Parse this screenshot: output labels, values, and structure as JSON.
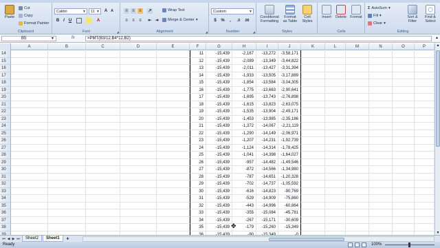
{
  "ribbon": {
    "clipboard": {
      "paste": "Paste",
      "cut": "Cut",
      "copy": "Copy",
      "format_painter": "Format Painter",
      "label": "Clipboard"
    },
    "font": {
      "name": "Calibri",
      "size": "11",
      "label": "Font"
    },
    "alignment": {
      "wrap": "Wrap Text",
      "merge": "Merge & Center",
      "label": "Alignment"
    },
    "number": {
      "format": "Custom",
      "label": "Number"
    },
    "styles": {
      "cond": "Conditional Formatting",
      "table": "Format as Table",
      "cell": "Cell Styles",
      "label": "Styles"
    },
    "cells": {
      "insert": "Insert",
      "delete": "Delete",
      "format": "Format",
      "label": "Cells"
    },
    "editing": {
      "autosum": "AutoSum",
      "fill": "Fill",
      "clear": "Clear",
      "sort": "Sort & Filter",
      "find": "Find & Select",
      "label": "Editing"
    }
  },
  "formula_bar": {
    "name_box": "B5",
    "fx": "fx",
    "formula": "=PMT(B3/12,B4*12,B2)"
  },
  "columns": [
    "A",
    "B",
    "C",
    "D",
    "E",
    "F",
    "G",
    "H",
    "I",
    "J",
    "K",
    "L",
    "M",
    "N",
    "O",
    "P"
  ],
  "rows": [
    {
      "n": "14",
      "f": "11",
      "g": "-15,439",
      "h": "-2,167",
      "i": "-13,272",
      "j": "-3,58,171"
    },
    {
      "n": "15",
      "f": "12",
      "g": "-15,439",
      "h": "-2,089",
      "i": "-13,349",
      "j": "-3,44,822"
    },
    {
      "n": "16",
      "f": "13",
      "g": "-15,439",
      "h": "-2,011",
      "i": "-13,427",
      "j": "-3,31,394"
    },
    {
      "n": "17",
      "f": "14",
      "g": "-15,439",
      "h": "-1,933",
      "i": "-13,505",
      "j": "-3,17,889"
    },
    {
      "n": "18",
      "f": "15",
      "g": "-15,439",
      "h": "-1,854",
      "i": "-13,584",
      "j": "-3,04,305"
    },
    {
      "n": "19",
      "f": "16",
      "g": "-15,439",
      "h": "-1,775",
      "i": "-13,663",
      "j": "-2,90,641"
    },
    {
      "n": "20",
      "f": "17",
      "g": "-15,439",
      "h": "-1,695",
      "i": "-13,743",
      "j": "-2,76,898"
    },
    {
      "n": "21",
      "f": "18",
      "g": "-15,439",
      "h": "-1,615",
      "i": "-13,823",
      "j": "-2,63,075"
    },
    {
      "n": "22",
      "f": "19",
      "g": "-15,439",
      "h": "-1,535",
      "i": "-13,904",
      "j": "-2,49,171"
    },
    {
      "n": "23",
      "f": "20",
      "g": "-15,439",
      "h": "-1,453",
      "i": "-13,985",
      "j": "-2,35,186"
    },
    {
      "n": "24",
      "f": "21",
      "g": "-15,439",
      "h": "-1,372",
      "i": "-14,067",
      "j": "-2,21,119"
    },
    {
      "n": "25",
      "f": "22",
      "g": "-15,439",
      "h": "-1,290",
      "i": "-14,149",
      "j": "-2,06,971"
    },
    {
      "n": "26",
      "f": "23",
      "g": "-15,439",
      "h": "-1,207",
      "i": "-14,231",
      "j": "-1,92,739"
    },
    {
      "n": "27",
      "f": "24",
      "g": "-15,439",
      "h": "-1,124",
      "i": "-14,314",
      "j": "-1,78,425"
    },
    {
      "n": "28",
      "f": "25",
      "g": "-15,439",
      "h": "-1,041",
      "i": "-14,398",
      "j": "-1,64,027"
    },
    {
      "n": "29",
      "f": "26",
      "g": "-15,439",
      "h": "-957",
      "i": "-14,482",
      "j": "-1,49,546"
    },
    {
      "n": "30",
      "f": "27",
      "g": "-15,439",
      "h": "-872",
      "i": "-14,566",
      "j": "-1,34,980"
    },
    {
      "n": "31",
      "f": "28",
      "g": "-15,439",
      "h": "-787",
      "i": "-14,651",
      "j": "-1,20,328"
    },
    {
      "n": "32",
      "f": "29",
      "g": "-15,439",
      "h": "-702",
      "i": "-14,737",
      "j": "-1,05,592"
    },
    {
      "n": "33",
      "f": "30",
      "g": "-15,439",
      "h": "-616",
      "i": "-14,823",
      "j": "-90,769"
    },
    {
      "n": "34",
      "f": "31",
      "g": "-15,439",
      "h": "-529",
      "i": "-14,909",
      "j": "-75,860"
    },
    {
      "n": "35",
      "f": "32",
      "g": "-15,439",
      "h": "-443",
      "i": "-14,996",
      "j": "-60,864"
    },
    {
      "n": "36",
      "f": "33",
      "g": "-15,439",
      "h": "-355",
      "i": "-15,084",
      "j": "-45,781"
    },
    {
      "n": "37",
      "f": "34",
      "g": "-15,439",
      "h": "-267",
      "i": "-15,171",
      "j": "-30,609"
    },
    {
      "n": "38",
      "f": "35",
      "g": "-15,439",
      "h": "-179",
      "i": "-15,260",
      "j": "-15,349"
    },
    {
      "n": "39",
      "f": "36",
      "g": "-15,439",
      "h": "-90",
      "i": "-15,349",
      "j": "-0"
    }
  ],
  "sheets": [
    "Sheet2",
    "Sheet1"
  ],
  "active_sheet": "Sheet1",
  "status": {
    "text": "Ready",
    "zoom": "100%"
  }
}
